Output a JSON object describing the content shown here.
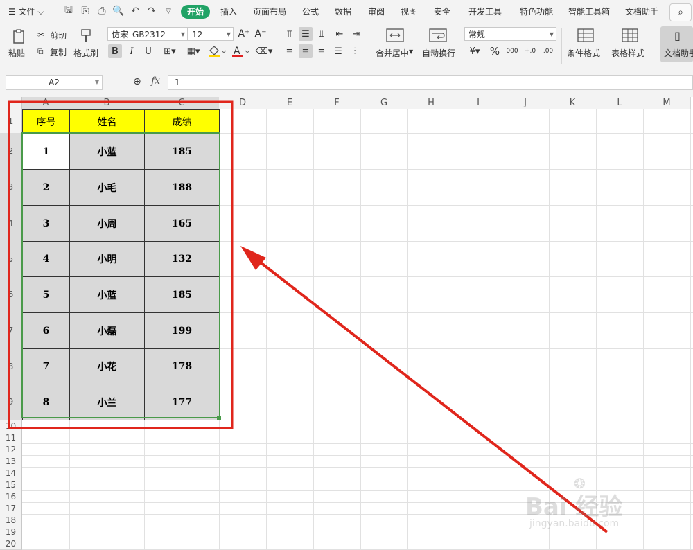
{
  "menubar": {
    "file_label": "☰ 文件 ⌵",
    "tabs": [
      "开始",
      "插入",
      "页面布局",
      "公式",
      "数据",
      "审阅",
      "视图",
      "安全",
      "开发工具",
      "特色功能",
      "智能工具箱",
      "文档助手"
    ]
  },
  "ribbon": {
    "paste": "粘贴",
    "cut": "剪切",
    "copy": "复制",
    "format_painter": "格式刷",
    "font_name": "仿宋_GB2312",
    "font_size": "12",
    "merge_center": "合并居中",
    "wrap_text": "自动换行",
    "number_format": "常规",
    "conditional_format": "条件格式",
    "table_style": "表格样式",
    "doc_assistant": "文档助手",
    "font_color_accent": "#e02020",
    "fill_color_accent": "#ffd400"
  },
  "formula_bar": {
    "name_box": "A2",
    "fx_label": "fx",
    "value": "1"
  },
  "sheet": {
    "columns": [
      "A",
      "B",
      "C",
      "D",
      "E",
      "F",
      "G",
      "H",
      "I",
      "J",
      "K",
      "L",
      "M"
    ],
    "rows": [
      "1",
      "2",
      "3",
      "4",
      "5",
      "6",
      "7",
      "8",
      "9",
      "10",
      "11",
      "12",
      "13",
      "14",
      "15",
      "16",
      "17",
      "18",
      "19",
      "20"
    ],
    "selected_range": "A2:C9",
    "table": {
      "headers": [
        "序号",
        "姓名",
        "成绩"
      ],
      "rows": [
        [
          "1",
          "小蓝",
          "185"
        ],
        [
          "2",
          "小毛",
          "188"
        ],
        [
          "3",
          "小周",
          "165"
        ],
        [
          "4",
          "小明",
          "132"
        ],
        [
          "5",
          "小蓝",
          "185"
        ],
        [
          "6",
          "小磊",
          "199"
        ],
        [
          "7",
          "小花",
          "178"
        ],
        [
          "8",
          "小兰",
          "177"
        ]
      ]
    },
    "header_fill": "#ffff00",
    "body_fill": "#d9d9d9",
    "annotation_color": "#e0261c"
  },
  "watermark": {
    "text": "Bai 经验",
    "url": "jingyan.baidu.com"
  }
}
